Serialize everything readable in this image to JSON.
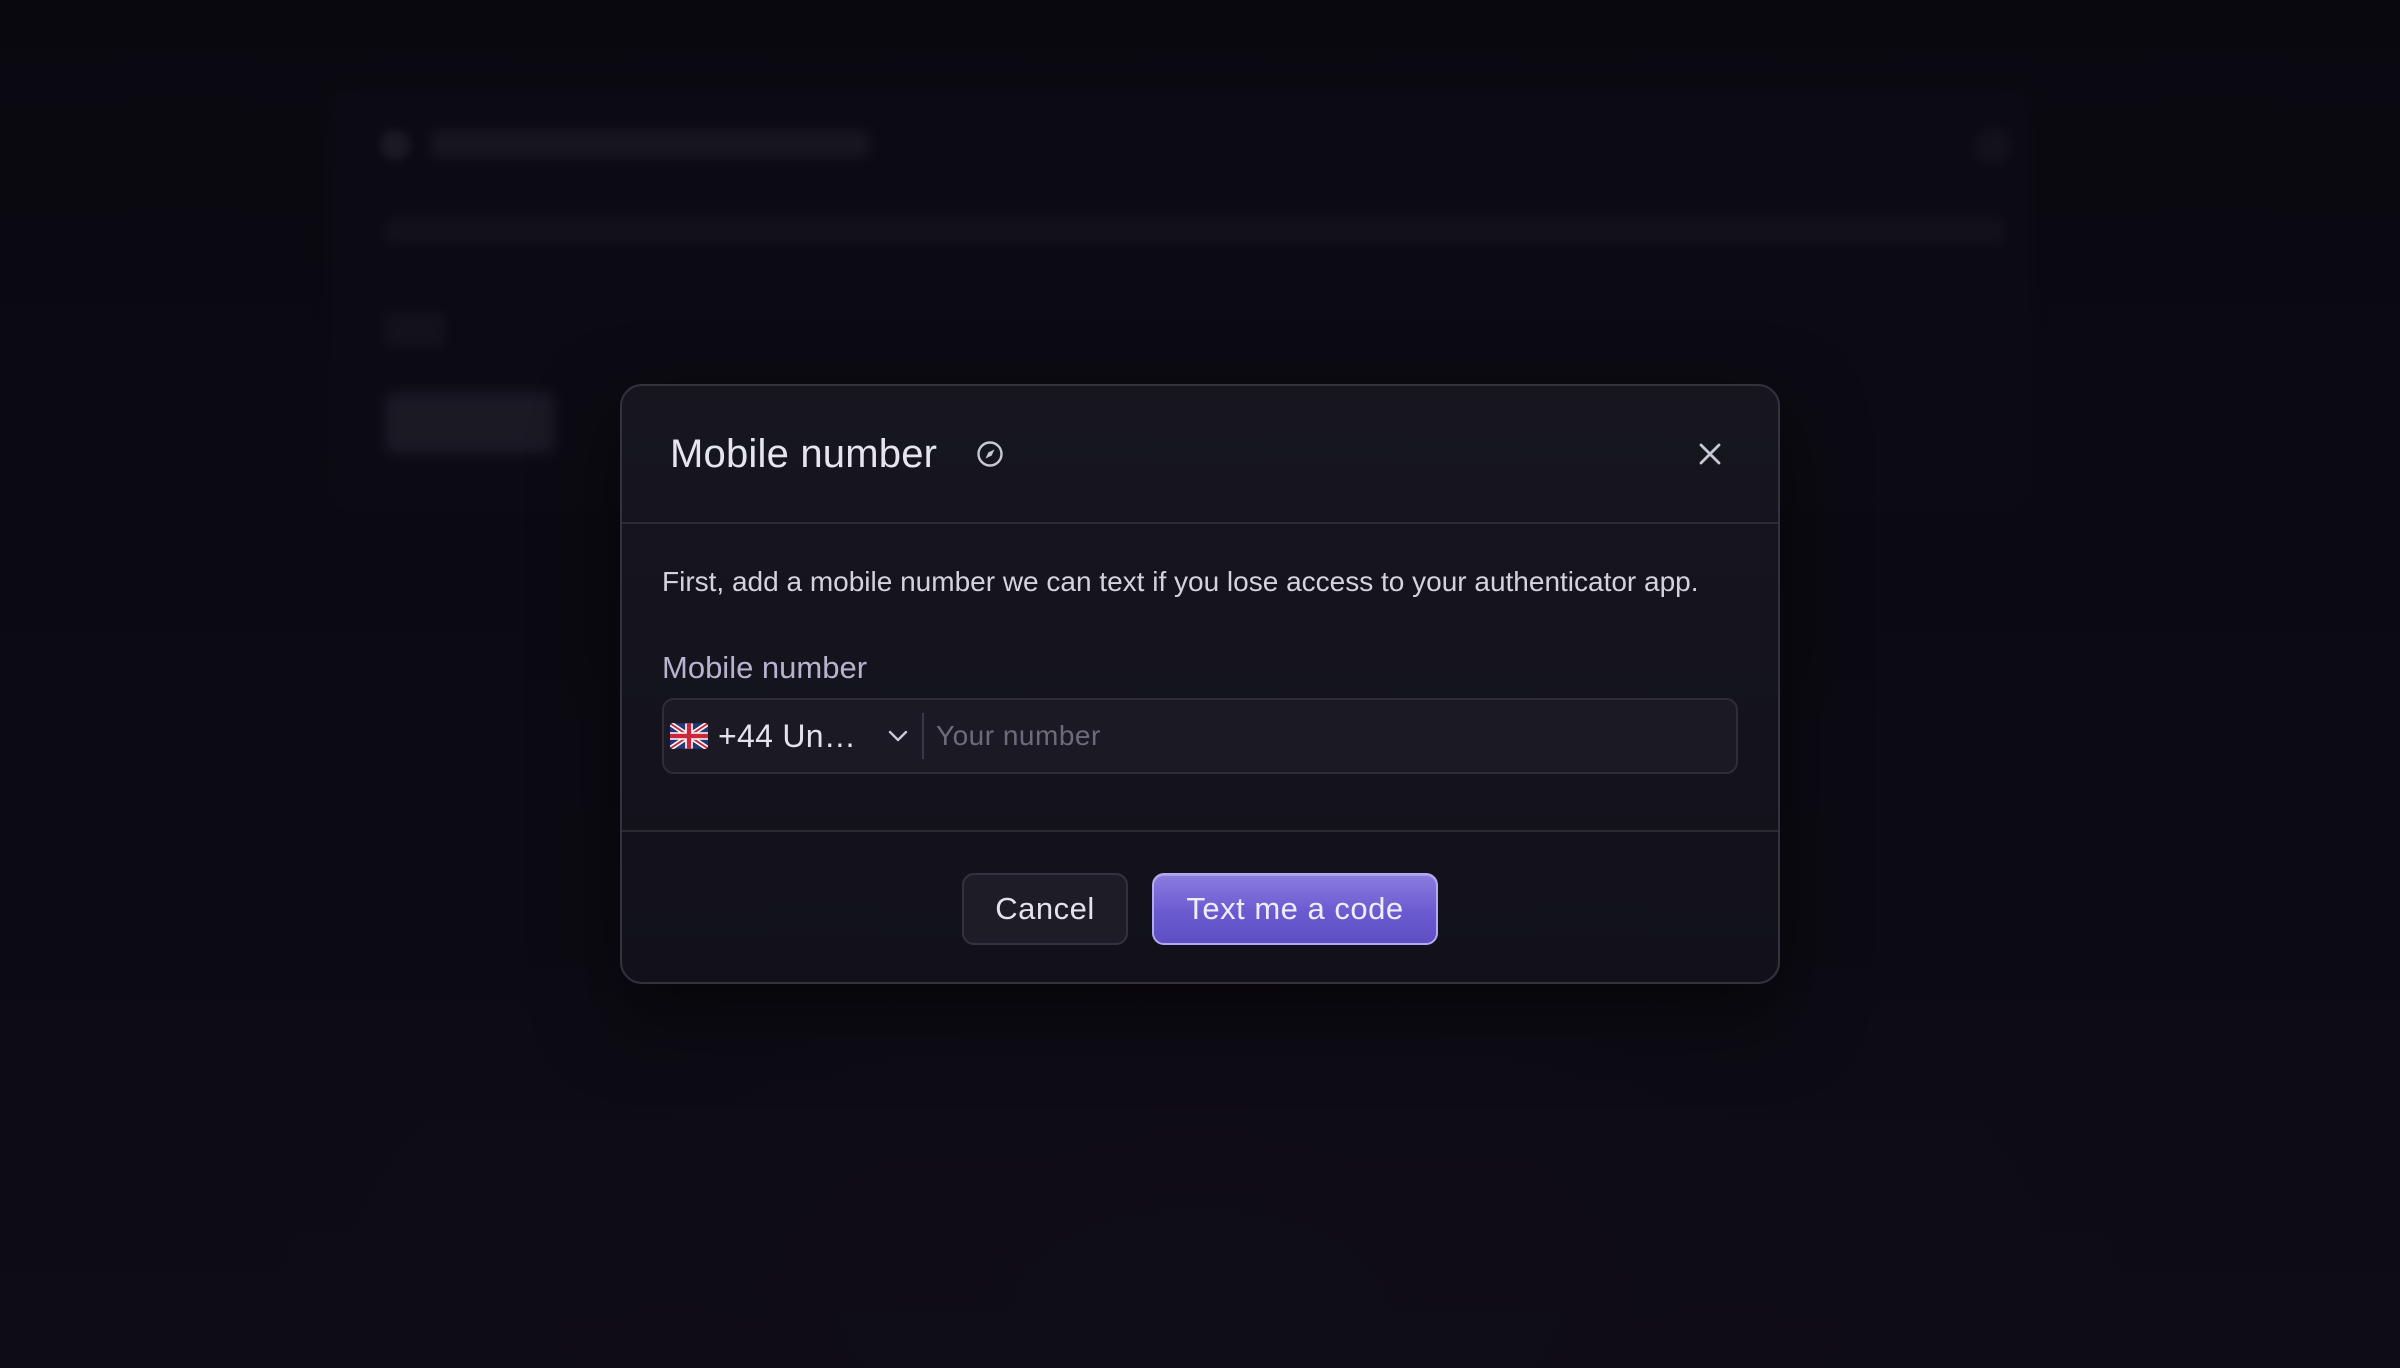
{
  "modal": {
    "title": "Mobile number",
    "title_icon": "compass-icon",
    "close_icon": "close-icon",
    "description": "First, add a mobile number we can text if you lose access to your authenticator app.",
    "field_label": "Mobile number",
    "country_select": {
      "flag": "uk-flag-icon",
      "value": "+44 Un…"
    },
    "phone_input": {
      "value": "",
      "placeholder": "Your number"
    },
    "cancel_label": "Cancel",
    "submit_label": "Text me a code"
  },
  "colors": {
    "accent": "#6a5ad0",
    "background": "#0c0b14",
    "modal_bg": "#15141d"
  }
}
